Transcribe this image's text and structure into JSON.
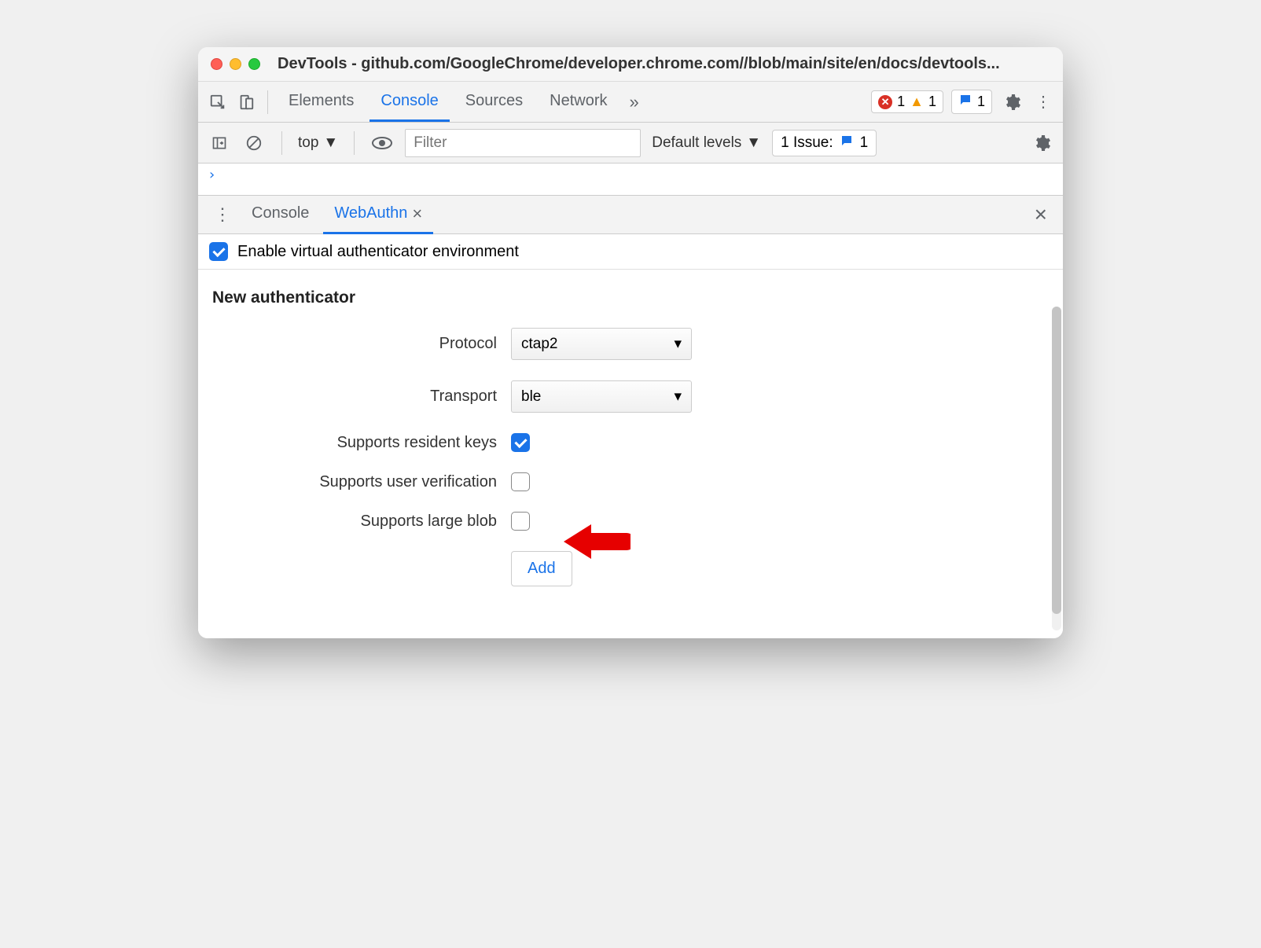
{
  "window": {
    "title": "DevTools - github.com/GoogleChrome/developer.chrome.com//blob/main/site/en/docs/devtools..."
  },
  "mainTabs": {
    "items": [
      "Elements",
      "Console",
      "Sources",
      "Network"
    ],
    "active": "Console",
    "errorCount": "1",
    "warnCount": "1",
    "msgCount": "1"
  },
  "consoleToolbar": {
    "context": "top",
    "filterPlaceholder": "Filter",
    "levels": "Default levels",
    "issueLabel": "1 Issue:",
    "issueCount": "1"
  },
  "drawer": {
    "tabs": [
      "Console",
      "WebAuthn"
    ],
    "active": "WebAuthn"
  },
  "webauthn": {
    "enableLabel": "Enable virtual authenticator environment",
    "enabled": true,
    "heading": "New authenticator",
    "fields": {
      "protocolLabel": "Protocol",
      "protocolValue": "ctap2",
      "transportLabel": "Transport",
      "transportValue": "ble",
      "residentKeysLabel": "Supports resident keys",
      "residentKeysChecked": true,
      "userVerificationLabel": "Supports user verification",
      "userVerificationChecked": false,
      "largeBlobLabel": "Supports large blob",
      "largeBlobChecked": false
    },
    "addButton": "Add"
  }
}
